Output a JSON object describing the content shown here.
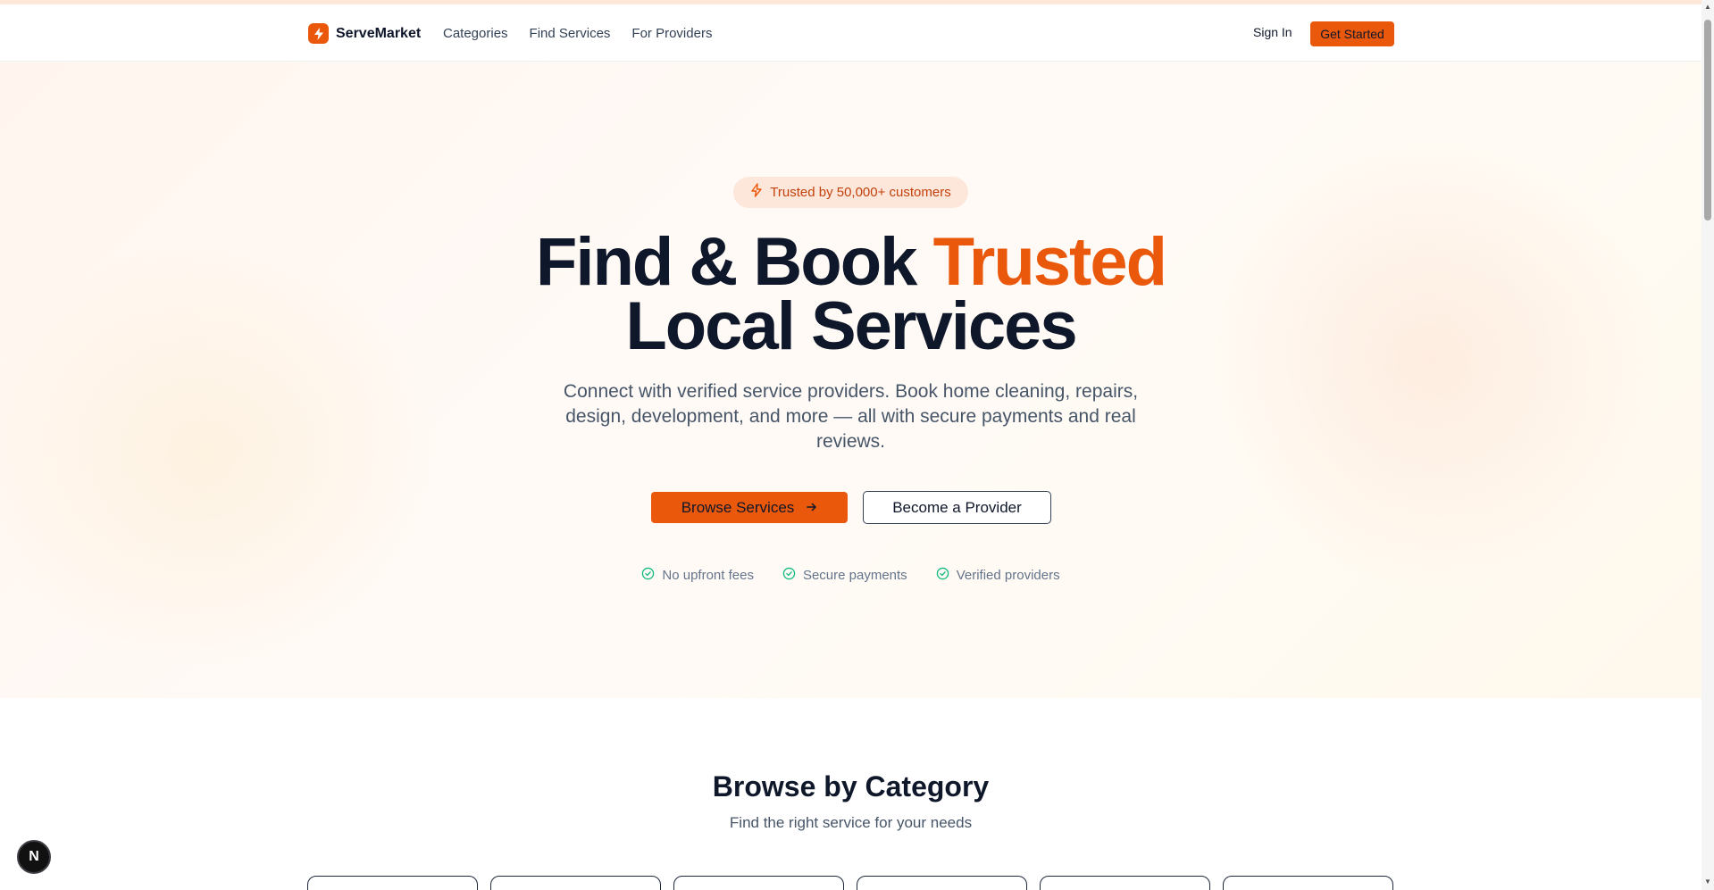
{
  "nav": {
    "brand": "ServeMarket",
    "links": [
      "Categories",
      "Find Services",
      "For Providers"
    ],
    "sign_in": "Sign In",
    "get_started": "Get Started"
  },
  "hero": {
    "badge": "Trusted by 50,000+ customers",
    "headline_part1": "Find & Book",
    "headline_accent": "Trusted",
    "headline_line2": "Local Services",
    "subtext": "Connect with verified service providers. Book home cleaning, repairs, design, development, and more — all with secure payments and real reviews.",
    "browse_button": "Browse Services",
    "provider_button": "Become a Provider",
    "features": [
      "No upfront fees",
      "Secure payments",
      "Verified providers"
    ]
  },
  "categories": {
    "title": "Browse by Category",
    "subtitle": "Find the right service for your needs"
  },
  "dev_indicator": "N",
  "colors": {
    "accent": "#ea580c",
    "text": "#0f172a",
    "muted": "#475569",
    "check": "#10b981"
  }
}
